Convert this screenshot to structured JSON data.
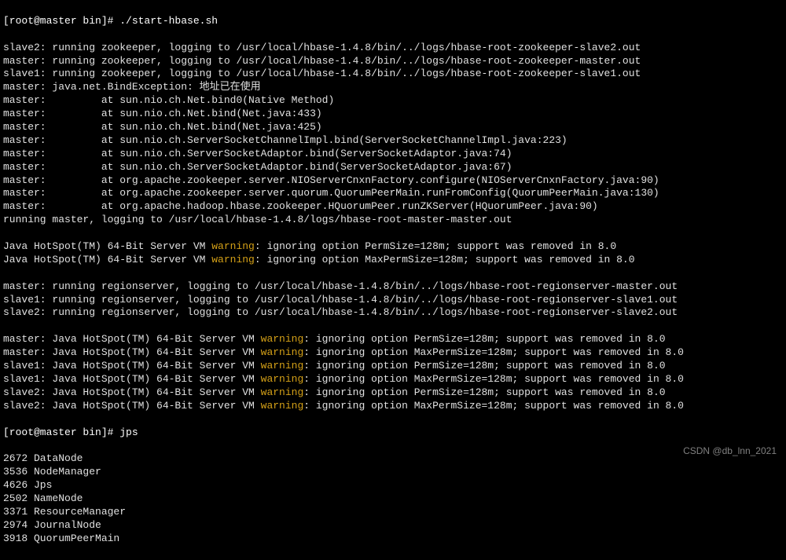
{
  "prompt1": "[root@master bin]# ./start-hbase.sh",
  "lines": [
    "slave2: running zookeeper, logging to /usr/local/hbase-1.4.8/bin/../logs/hbase-root-zookeeper-slave2.out",
    "master: running zookeeper, logging to /usr/local/hbase-1.4.8/bin/../logs/hbase-root-zookeeper-master.out",
    "slave1: running zookeeper, logging to /usr/local/hbase-1.4.8/bin/../logs/hbase-root-zookeeper-slave1.out",
    "master: java.net.BindException: 地址已在使用",
    "master:         at sun.nio.ch.Net.bind0(Native Method)",
    "master:         at sun.nio.ch.Net.bind(Net.java:433)",
    "master:         at sun.nio.ch.Net.bind(Net.java:425)",
    "master:         at sun.nio.ch.ServerSocketChannelImpl.bind(ServerSocketChannelImpl.java:223)",
    "master:         at sun.nio.ch.ServerSocketAdaptor.bind(ServerSocketAdaptor.java:74)",
    "master:         at sun.nio.ch.ServerSocketAdaptor.bind(ServerSocketAdaptor.java:67)",
    "master:         at org.apache.zookeeper.server.NIOServerCnxnFactory.configure(NIOServerCnxnFactory.java:90)",
    "master:         at org.apache.zookeeper.server.quorum.QuorumPeerMain.runFromConfig(QuorumPeerMain.java:130)",
    "master:         at org.apache.hadoop.hbase.zookeeper.HQuorumPeer.runZKServer(HQuorumPeer.java:90)",
    "running master, logging to /usr/local/hbase-1.4.8/logs/hbase-root-master-master.out"
  ],
  "warn_lines_a": [
    {
      "prefix": "Java HotSpot(TM) 64-Bit Server VM ",
      "warn": "warning",
      "suffix": ": ignoring option PermSize=128m; support was removed in 8.0"
    },
    {
      "prefix": "Java HotSpot(TM) 64-Bit Server VM ",
      "warn": "warning",
      "suffix": ": ignoring option MaxPermSize=128m; support was removed in 8.0"
    }
  ],
  "region_lines": [
    "master: running regionserver, logging to /usr/local/hbase-1.4.8/bin/../logs/hbase-root-regionserver-master.out",
    "slave1: running regionserver, logging to /usr/local/hbase-1.4.8/bin/../logs/hbase-root-regionserver-slave1.out",
    "slave2: running regionserver, logging to /usr/local/hbase-1.4.8/bin/../logs/hbase-root-regionserver-slave2.out"
  ],
  "warn_lines_b": [
    {
      "prefix": "master: Java HotSpot(TM) 64-Bit Server VM ",
      "warn": "warning",
      "suffix": ": ignoring option PermSize=128m; support was removed in 8.0"
    },
    {
      "prefix": "master: Java HotSpot(TM) 64-Bit Server VM ",
      "warn": "warning",
      "suffix": ": ignoring option MaxPermSize=128m; support was removed in 8.0"
    },
    {
      "prefix": "slave1: Java HotSpot(TM) 64-Bit Server VM ",
      "warn": "warning",
      "suffix": ": ignoring option PermSize=128m; support was removed in 8.0"
    },
    {
      "prefix": "slave1: Java HotSpot(TM) 64-Bit Server VM ",
      "warn": "warning",
      "suffix": ": ignoring option MaxPermSize=128m; support was removed in 8.0"
    },
    {
      "prefix": "slave2: Java HotSpot(TM) 64-Bit Server VM ",
      "warn": "warning",
      "suffix": ": ignoring option PermSize=128m; support was removed in 8.0"
    },
    {
      "prefix": "slave2: Java HotSpot(TM) 64-Bit Server VM ",
      "warn": "warning",
      "suffix": ": ignoring option MaxPermSize=128m; support was removed in 8.0"
    }
  ],
  "prompt2": "[root@master bin]# jps",
  "jps_output": [
    "2672 DataNode",
    "3536 NodeManager",
    "4626 Jps",
    "2502 NameNode",
    "3371 ResourceManager",
    "2974 JournalNode",
    "3918 QuorumPeerMain"
  ],
  "watermark": "CSDN @db_lnn_2021"
}
